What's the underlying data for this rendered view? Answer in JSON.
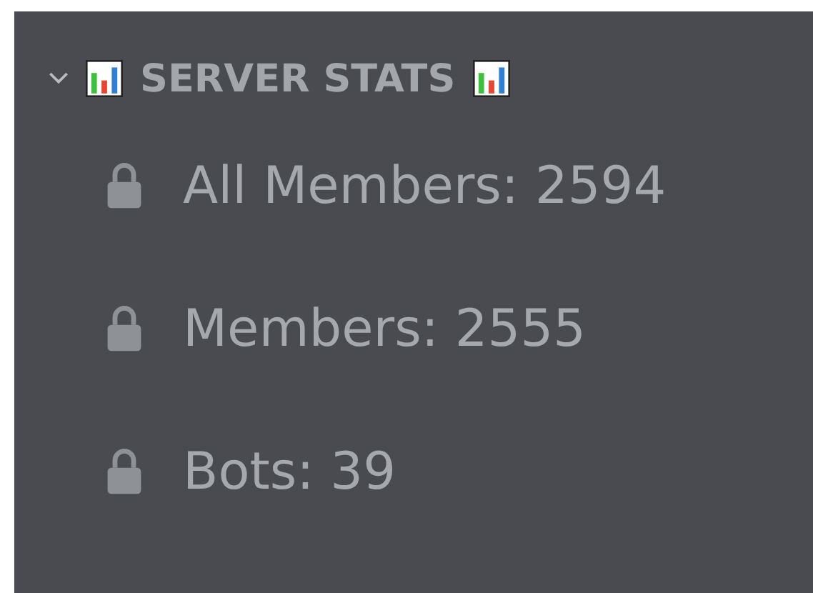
{
  "category": {
    "name": "SERVER STATS",
    "expanded": true
  },
  "channels": [
    {
      "name": "All Members: 2594"
    },
    {
      "name": "Members: 2555"
    },
    {
      "name": "Bots: 39"
    }
  ]
}
